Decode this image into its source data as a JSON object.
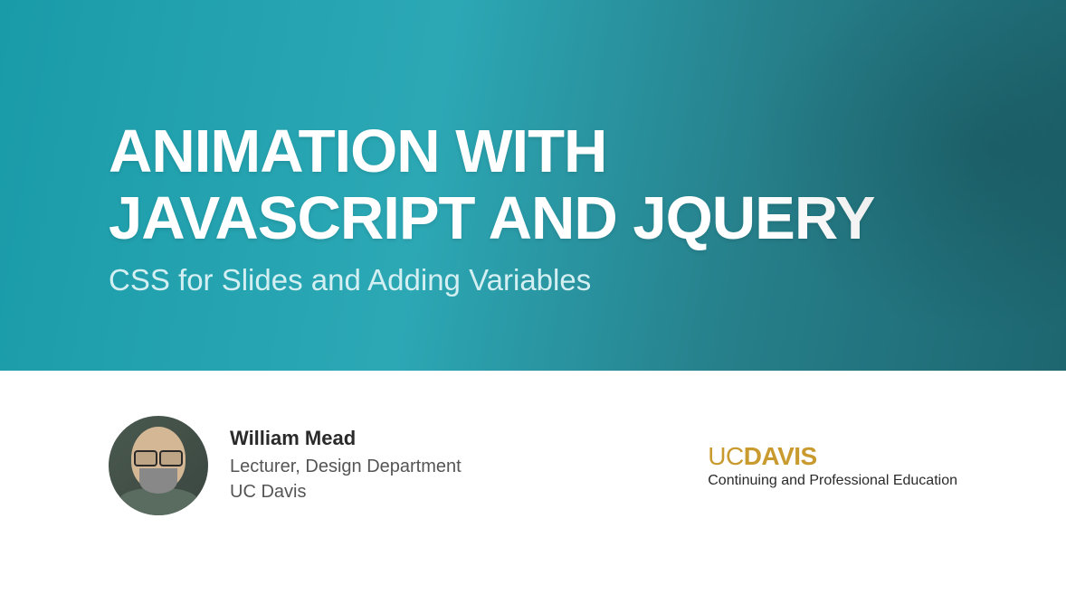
{
  "hero": {
    "title_line1": "ANIMATION WITH",
    "title_line2": "JAVASCRIPT AND JQUERY",
    "subtitle": "CSS for Slides and Adding Variables"
  },
  "presenter": {
    "name": "William Mead",
    "role": "Lecturer, Design Department",
    "org": "UC Davis"
  },
  "institution": {
    "logo_prefix": "UC",
    "logo_main": "DAVIS",
    "tagline": "Continuing and Professional Education"
  }
}
